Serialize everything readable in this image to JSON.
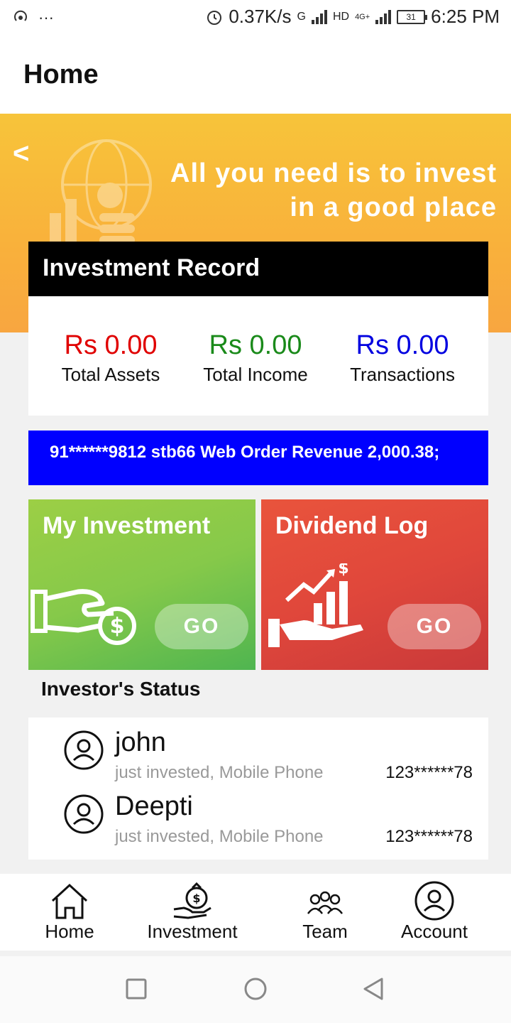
{
  "status_bar": {
    "speed": "0.37K/s",
    "network_g": "G",
    "network_hd": "HD",
    "network_4g": "4G+",
    "battery": "31",
    "time": "6:25 PM"
  },
  "app_bar": {
    "title": "Home"
  },
  "banner": {
    "back": "<",
    "line1": "All you need is to invest",
    "line2": "in a good place"
  },
  "record": {
    "title": "Investment Record",
    "stats": [
      {
        "amount": "Rs 0.00",
        "label": "Total Assets",
        "color": "#e00000"
      },
      {
        "amount": "Rs 0.00",
        "label": "Total Income",
        "color": "#1a8a1a"
      },
      {
        "amount": "Rs 0.00",
        "label": "Transactions",
        "color": "#0000e0"
      }
    ]
  },
  "ticker": {
    "text": "91******9812 stb66 Web Order Revenue 2,000.38;"
  },
  "tiles": {
    "investment": {
      "title": "My Investment",
      "button": "GO"
    },
    "dividend": {
      "title": "Dividend Log",
      "button": "GO"
    }
  },
  "investors": {
    "heading": "Investor's Status",
    "items": [
      {
        "name": "john",
        "desc": "just invested, Mobile Phone",
        "phone": "123******78"
      },
      {
        "name": "Deepti",
        "desc": "just invested, Mobile Phone",
        "phone": "123******78"
      }
    ]
  },
  "bottom_nav": {
    "items": [
      {
        "label": "Home",
        "icon": "home-icon"
      },
      {
        "label": "Investment",
        "icon": "money-bag-hand-icon"
      },
      {
        "label": "Team",
        "icon": "team-icon"
      },
      {
        "label": "Account",
        "icon": "user-circle-icon"
      }
    ]
  },
  "colors": {
    "banner": "#f9b13b",
    "ticker": "#0000ff",
    "investment_tile": "#86c94a",
    "dividend_tile": "#e0473b"
  }
}
